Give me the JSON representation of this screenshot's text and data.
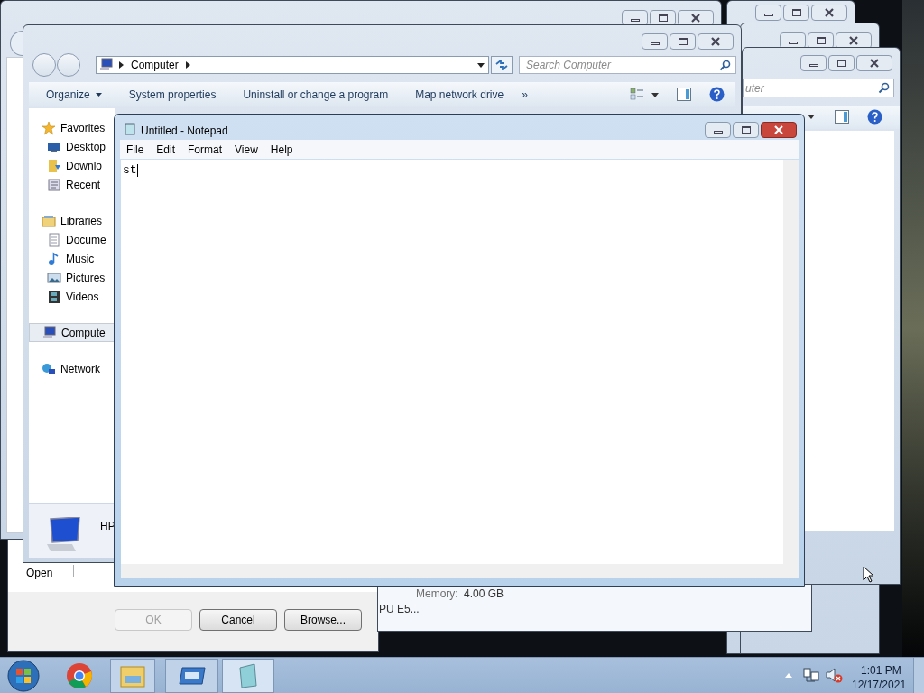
{
  "run_dialog": {
    "open_label": "Open",
    "buttons": [
      {
        "label": "OK",
        "disabled": true
      },
      {
        "label": "Cancel",
        "disabled": false
      },
      {
        "label": "Browse...",
        "disabled": false
      }
    ]
  },
  "system_window": {
    "memory_label": "Memory:",
    "memory_value": "4.00 GB",
    "processor": "PU E5..."
  },
  "right_explorer": {
    "search_placeholder": "uter"
  },
  "explorer": {
    "breadcrumb": [
      "Computer"
    ],
    "search_placeholder": "Search Computer",
    "toolbar": [
      {
        "label": "Organize",
        "dropdown": true
      },
      {
        "label": "System properties",
        "dropdown": false
      },
      {
        "label": "Uninstall or change a program",
        "dropdown": false
      },
      {
        "label": "Map network drive",
        "dropdown": false
      }
    ],
    "overflow": "»",
    "nav": [
      {
        "label": "Favorites",
        "kind": "star",
        "selected": false,
        "children": [
          {
            "label": "Desktop",
            "kind": "desktop",
            "selected": false
          },
          {
            "label": "Downlo",
            "kind": "download",
            "selected": false
          },
          {
            "label": "Recent",
            "kind": "recent",
            "selected": false
          }
        ]
      },
      {
        "label": "Libraries",
        "kind": "library",
        "selected": false,
        "children": [
          {
            "label": "Docume",
            "kind": "document",
            "selected": false
          },
          {
            "label": "Music",
            "kind": "music",
            "selected": false
          },
          {
            "label": "Pictures",
            "kind": "pictures",
            "selected": false
          },
          {
            "label": "Videos",
            "kind": "videos",
            "selected": false
          }
        ]
      },
      {
        "label": "Compute",
        "kind": "computer",
        "selected": true
      },
      {
        "label": "Network",
        "kind": "network",
        "selected": false
      }
    ],
    "details_name": "HP"
  },
  "notepad": {
    "title": "Untitled - Notepad",
    "menu": [
      "File",
      "Edit",
      "Format",
      "View",
      "Help"
    ],
    "text": "st"
  },
  "clock": {
    "time": "1:01 PM",
    "date": "12/17/2021"
  }
}
